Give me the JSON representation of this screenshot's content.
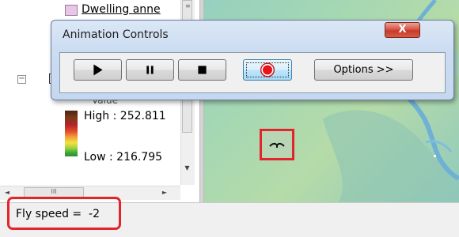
{
  "toc": {
    "layer_name": "Dwelling anne",
    "value_label": "Value",
    "toggle_glyph": "−",
    "legend": {
      "high": "High : 252.811",
      "low": "Low : 216.795"
    },
    "scrollbar_down_arrow": "▼",
    "scrollbar_grip": "≡"
  },
  "hscroll": {
    "left_arrow": "◄",
    "right_arrow": "►",
    "grip": "III"
  },
  "anim_window": {
    "title": "Animation Controls",
    "close_label": "X",
    "buttons": {
      "play": "play-icon",
      "pause": "pause-icon",
      "stop": "stop-icon",
      "record": "record-icon",
      "options_label": "Options >>"
    }
  },
  "status_bar": {
    "fly_speed": "Fly speed =  -2"
  },
  "colors": {
    "highlight": "#e3242b",
    "record_fill": "#e8141c",
    "map_water": "#7fb8d6"
  }
}
